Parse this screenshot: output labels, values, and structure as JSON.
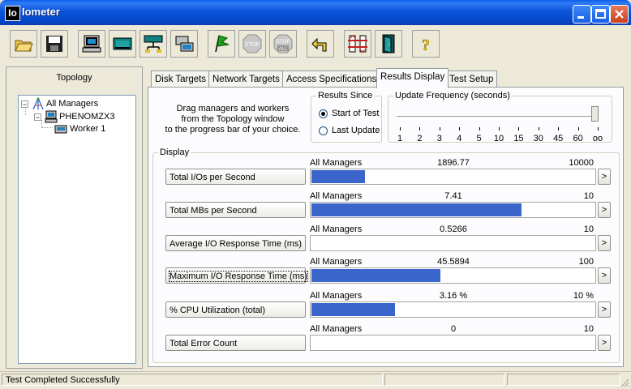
{
  "window": {
    "logo": "Io",
    "title": "Iometer"
  },
  "toolbar": {
    "buttons": [
      {
        "icon": "open-folder-icon"
      },
      {
        "icon": "save-disk-icon"
      },
      {
        "icon": "new-manager-icon"
      },
      {
        "icon": "new-disk-worker-icon"
      },
      {
        "icon": "new-network-worker-icon"
      },
      {
        "icon": "copy-worker-icon"
      },
      {
        "icon": "start-flag-icon"
      },
      {
        "icon": "stop-icon",
        "label": "STOP"
      },
      {
        "icon": "stop-all-icon",
        "label_top": "STOP",
        "label_bottom": "ALL"
      },
      {
        "icon": "reset-arrow-icon"
      },
      {
        "icon": "disconnect-icon"
      },
      {
        "icon": "exit-door-icon"
      },
      {
        "icon": "help-icon",
        "label": "?"
      }
    ]
  },
  "topology": {
    "title": "Topology",
    "all_managers": "All Managers",
    "manager": "PHENOMZX3",
    "worker": "Worker 1",
    "expand_symbol": "⊟"
  },
  "tabs": [
    {
      "label": "Disk Targets",
      "active": false
    },
    {
      "label": "Network Targets",
      "active": false
    },
    {
      "label": "Access Specifications",
      "active": false
    },
    {
      "label": "Results Display",
      "active": true
    },
    {
      "label": "Test Setup",
      "active": false
    }
  ],
  "results": {
    "instructions": [
      "Drag managers and workers",
      "from the Topology window",
      "to the progress bar of your choice."
    ],
    "results_since": {
      "title": "Results Since",
      "options": [
        {
          "label": "Start of Test",
          "selected": true
        },
        {
          "label": "Last Update",
          "selected": false
        }
      ]
    },
    "update_frequency": {
      "title": "Update Frequency (seconds)",
      "ticks": [
        "1",
        "2",
        "3",
        "4",
        "5",
        "10",
        "15",
        "30",
        "45",
        "60",
        "oo"
      ],
      "selected": "oo"
    },
    "display_title": "Display",
    "metrics": [
      {
        "label": "Total I/Os per Second",
        "source": "All Managers",
        "value": "1896.77",
        "max": "10000",
        "fraction": 0.19,
        "focused": false
      },
      {
        "label": "Total MBs per Second",
        "source": "All Managers",
        "value": "7.41",
        "max": "10",
        "fraction": 0.741,
        "focused": false
      },
      {
        "label": "Average I/O Response Time (ms)",
        "source": "All Managers",
        "value": "0.5266",
        "max": "10",
        "fraction": 0.0,
        "focused": false
      },
      {
        "label": "Maximum I/O Response Time (ms)",
        "source": "All Managers",
        "value": "45.5894",
        "max": "100",
        "fraction": 0.456,
        "focused": true
      },
      {
        "label": "% CPU Utilization (total)",
        "source": "All Managers",
        "value": "3.16 %",
        "max": "10 %",
        "fraction": 0.295,
        "focused": false
      },
      {
        "label": "Total Error Count",
        "source": "All Managers",
        "value": "0",
        "max": "10",
        "fraction": 0.0,
        "focused": false
      }
    ],
    "more_symbol": ">"
  },
  "statusbar": {
    "text": "Test Completed Successfully"
  },
  "colors": {
    "bar_fill": "#3a65cb",
    "titlebar": "#0b55da"
  }
}
